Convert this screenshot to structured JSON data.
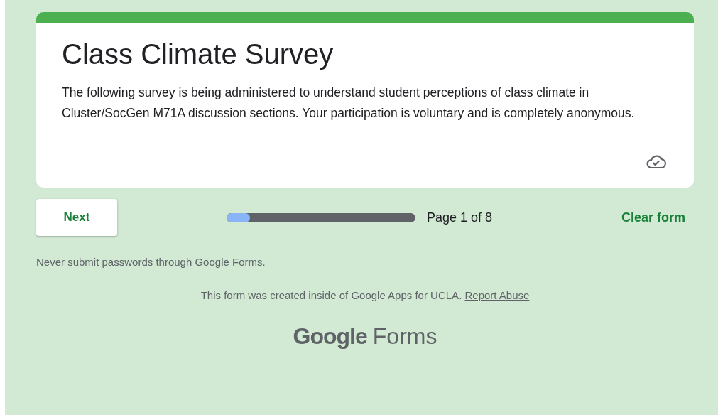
{
  "form": {
    "title": "Class Climate Survey",
    "description": "The following survey is being administered to understand student perceptions of class climate in Cluster/SocGen M71A discussion sections. Your participation is voluntary and is completely anonymous.",
    "saved": true
  },
  "navigation": {
    "next_button": "Next",
    "progress": {
      "level": 0.125,
      "label": "Page 1 of 8"
    },
    "clear_button": "Clear form"
  },
  "footer": {
    "warning": "Never submit passwords through Google Forms.",
    "notice": "This form was created inside of Google Apps for UCLA.",
    "report_link": "Report Abuse",
    "logo": {
      "brand": "Google",
      "product": "Forms"
    }
  }
}
